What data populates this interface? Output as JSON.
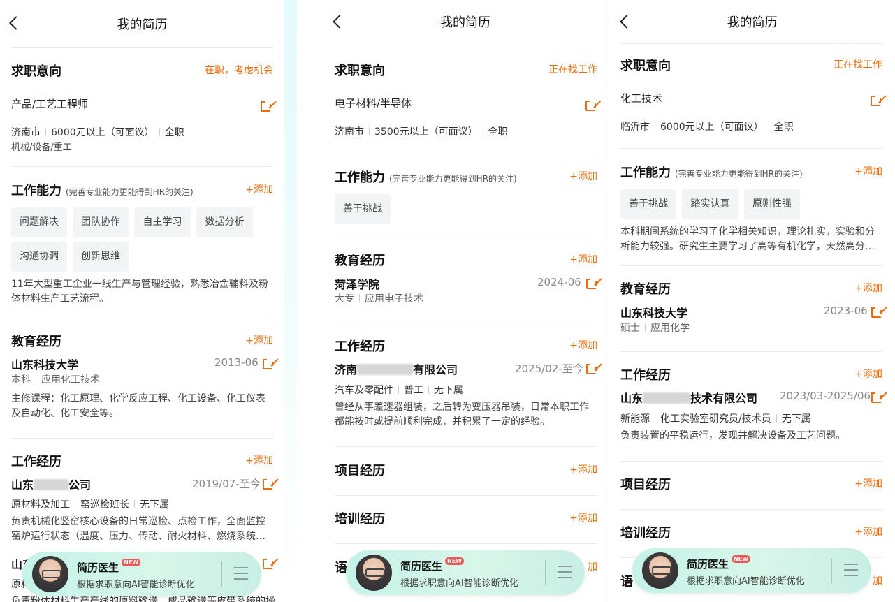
{
  "panels": [
    {
      "title": "我的简历",
      "intent": {
        "heading": "求职意向",
        "status": "在职，考虑机会",
        "position": "产品/工艺工程师",
        "city": "济南市",
        "salary": "6000元以上（可面议）",
        "type": "全职",
        "industry": "机械/设备/重工"
      },
      "skills": {
        "heading": "工作能力",
        "note": "(完善专业能力更能得到HR的关注)",
        "add": "+添加",
        "tags": [
          "问题解决",
          "团队协作",
          "自主学习",
          "数据分析",
          "沟通协调",
          "创新思维"
        ],
        "desc": "11年大型重工企业一线生产与管理经验，熟悉冶金辅料及粉体材料生产工艺流程。"
      },
      "education": {
        "heading": "教育经历",
        "add": "+添加",
        "school": "山东科技大学",
        "date": "2013-06",
        "degree": "本科",
        "major": "应用化工技术",
        "desc": "主修课程：化工原理、化学反应工程、化工设备、化工仪表及自动化、化工安全等。"
      },
      "work": {
        "heading": "工作经历",
        "add": "+添加",
        "company_pre": "山东",
        "company_post": "公司",
        "date": "2019/07-至今",
        "industry": "原材料及加工",
        "role": "窑巡检班长",
        "subordinates": "无下属",
        "desc": "负责机械化竖窑核心设备的日常巡检、点检工作，全面监控窑炉运行状态（温度、压力、传动、耐火材料、燃烧系统…",
        "next_company": "山东",
        "next_role_prefix": "原料",
        "next_desc": "负责粉体材料生产产线的原料输送、成品输送等皮带系统的操"
      }
    },
    {
      "title": "我的简历",
      "intent": {
        "heading": "求职意向",
        "status": "正在找工作",
        "position": "电子材料/半导体",
        "city": "济南市",
        "salary": "3500元以上（可面议）",
        "type": "全职"
      },
      "skills": {
        "heading": "工作能力",
        "note": "(完善专业能力更能得到HR的关注)",
        "add": "+添加",
        "tags": [
          "善于挑战"
        ]
      },
      "education": {
        "heading": "教育经历",
        "add": "+添加",
        "school": "菏泽学院",
        "date": "2024-06",
        "degree": "大专",
        "major": "应用电子技术"
      },
      "work": {
        "heading": "工作经历",
        "add": "+添加",
        "company_pre": "济南",
        "company_post": "有限公司",
        "date": "2025/02-至今",
        "industry": "汽车及零配件",
        "role": "普工",
        "subordinates": "无下属",
        "desc": "曾经从事差速器组装，之后转为变压器吊装，日常本职工作都能按时或提前顺利完成，并积累了一定的经验。"
      },
      "projects": {
        "heading": "项目经历",
        "add": "+添加"
      },
      "training": {
        "heading": "培训经历",
        "add": "+添加"
      },
      "language": {
        "heading": "语",
        "add": "加"
      }
    },
    {
      "title": "我的简历",
      "intent": {
        "heading": "求职意向",
        "status": "正在找工作",
        "position": "化工技术",
        "city": "临沂市",
        "salary": "6000元以上（可面议）",
        "type": "全职"
      },
      "skills": {
        "heading": "工作能力",
        "note": "(完善专业能力更能得到HR的关注)",
        "add": "+添加",
        "tags": [
          "善于挑战",
          "踏实认真",
          "原则性强"
        ],
        "desc": "本科期间系统的学习了化学相关知识，理论扎实，实验和分析能力较强。研究生主要学习了高等有机化学，天然高分…"
      },
      "education": {
        "heading": "教育经历",
        "add": "+添加",
        "school": "山东科技大学",
        "date": "2023-06",
        "degree": "硕士",
        "major": "应用化学"
      },
      "work": {
        "heading": "工作经历",
        "add": "+添加",
        "company_pre": "山东",
        "company_post": "技术有限公司",
        "date": "2023/03-2025/06",
        "industry": "新能源",
        "role": "化工实验室研究员/技术员",
        "subordinates": "无下属",
        "desc": "负责装置的平稳运行，发现并解决设备及工艺问题。"
      },
      "projects": {
        "heading": "项目经历",
        "add": "+添加"
      },
      "training": {
        "heading": "培训经历",
        "add": "+添加"
      },
      "language": {
        "heading": "语",
        "add": "加"
      }
    }
  ],
  "banner": {
    "title": "简历医生",
    "badge": "NEW",
    "subtitle": "根据求职意向AI智能诊断优化"
  },
  "colors": {
    "accent": "#f26b0a",
    "banner": "#c4f3e8"
  }
}
